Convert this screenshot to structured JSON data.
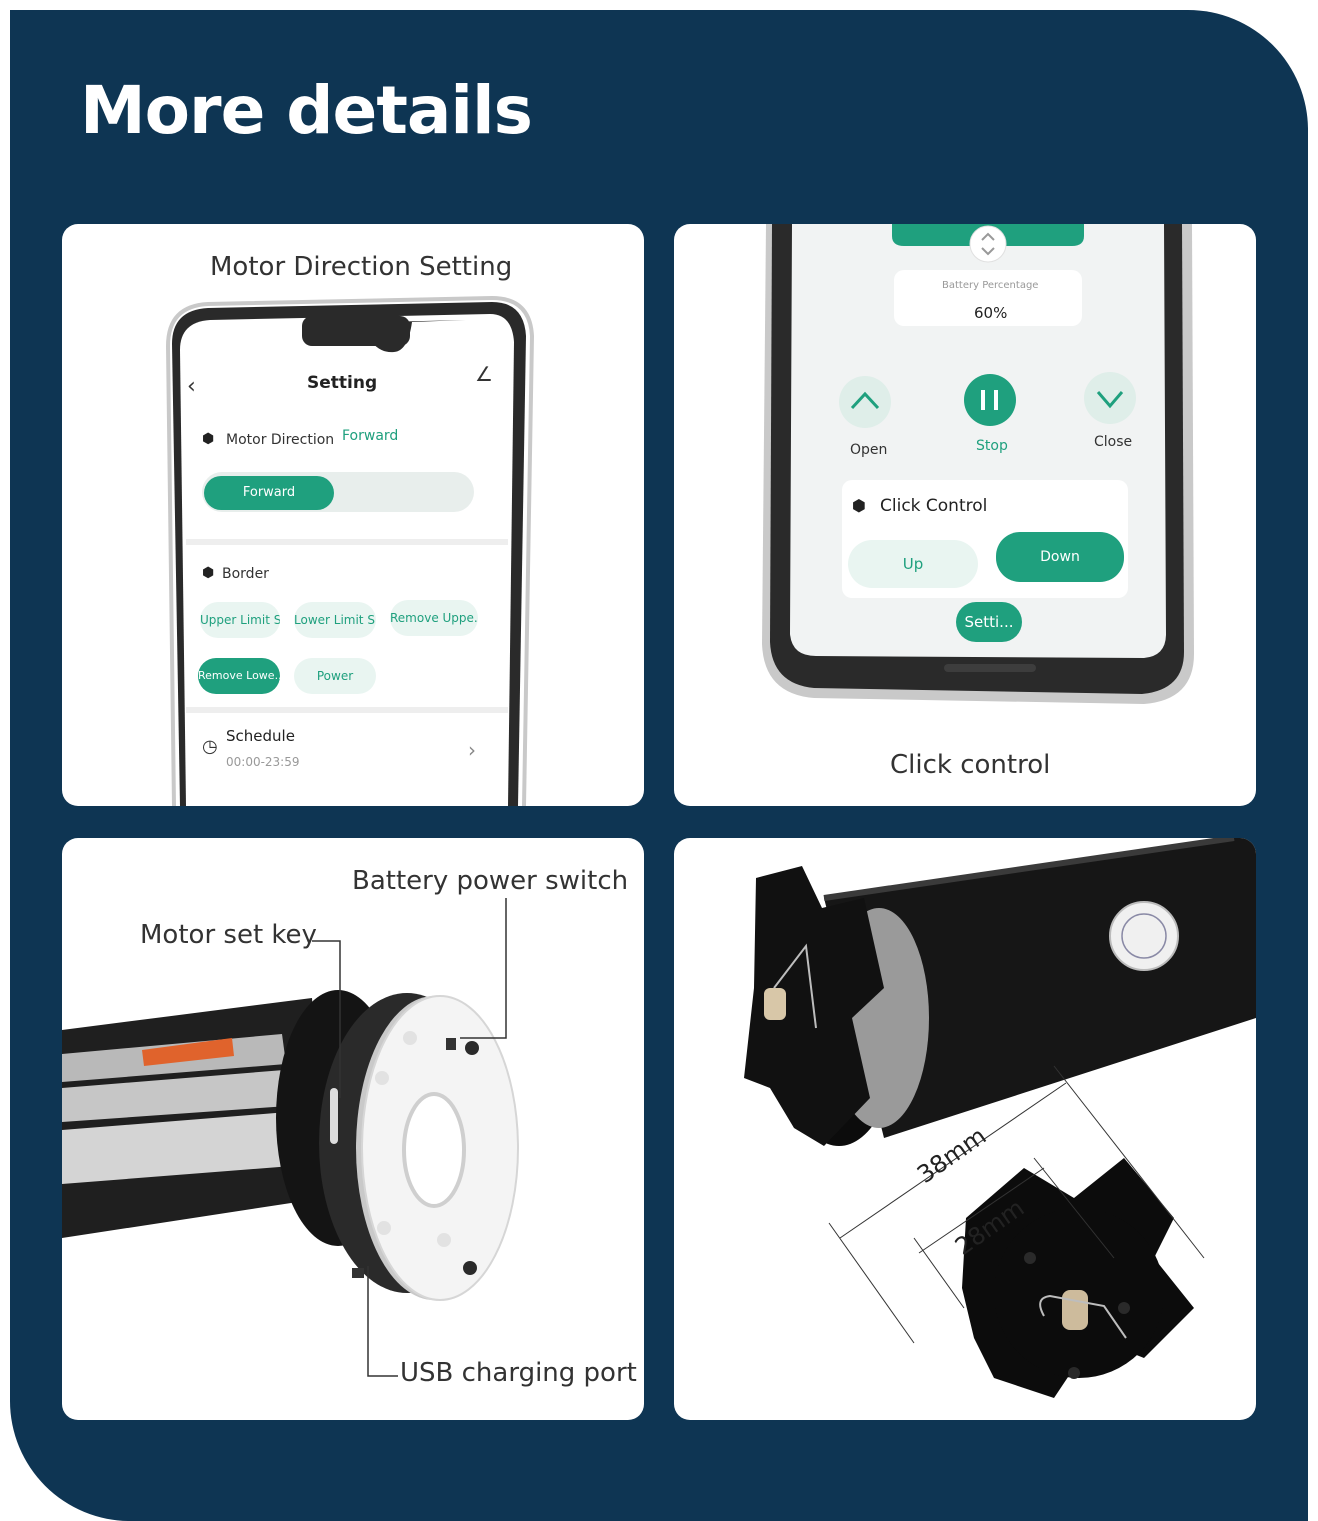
{
  "page": {
    "title": "More details",
    "colors": {
      "background": "#0e3553",
      "accent": "#1fa07e",
      "panel": "#ffffff"
    }
  },
  "panel_direction": {
    "caption": "Motor Direction Setting",
    "screen": {
      "back_icon": "chevron-left-icon",
      "header": "Setting",
      "motor_direction_label": "Motor Direction",
      "motor_direction_value": "Forward",
      "toggle_selected": "Forward",
      "border_label": "Border",
      "border_buttons": [
        "Upper Limit S...",
        "Lower Limit S...",
        "Remove Uppe...",
        "Remove Lowe...",
        "Power"
      ],
      "schedule_label": "Schedule",
      "schedule_time": "00:00-23:59"
    }
  },
  "panel_click": {
    "caption": "Click control",
    "screen": {
      "battery_label": "Battery Percentage",
      "battery_value": "60%",
      "open_label": "Open",
      "stop_label": "Stop",
      "close_label": "Close",
      "click_control_label": "Click Control",
      "up_label": "Up",
      "down_label": "Down",
      "settings_label": "Setti..."
    }
  },
  "panel_motor": {
    "battery_switch_label": "Battery power switch",
    "motor_key_label": "Motor set key",
    "usb_label": "USB charging port"
  },
  "panel_dimensions": {
    "outer_diameter": "38mm",
    "inner_diameter": "28mm"
  }
}
